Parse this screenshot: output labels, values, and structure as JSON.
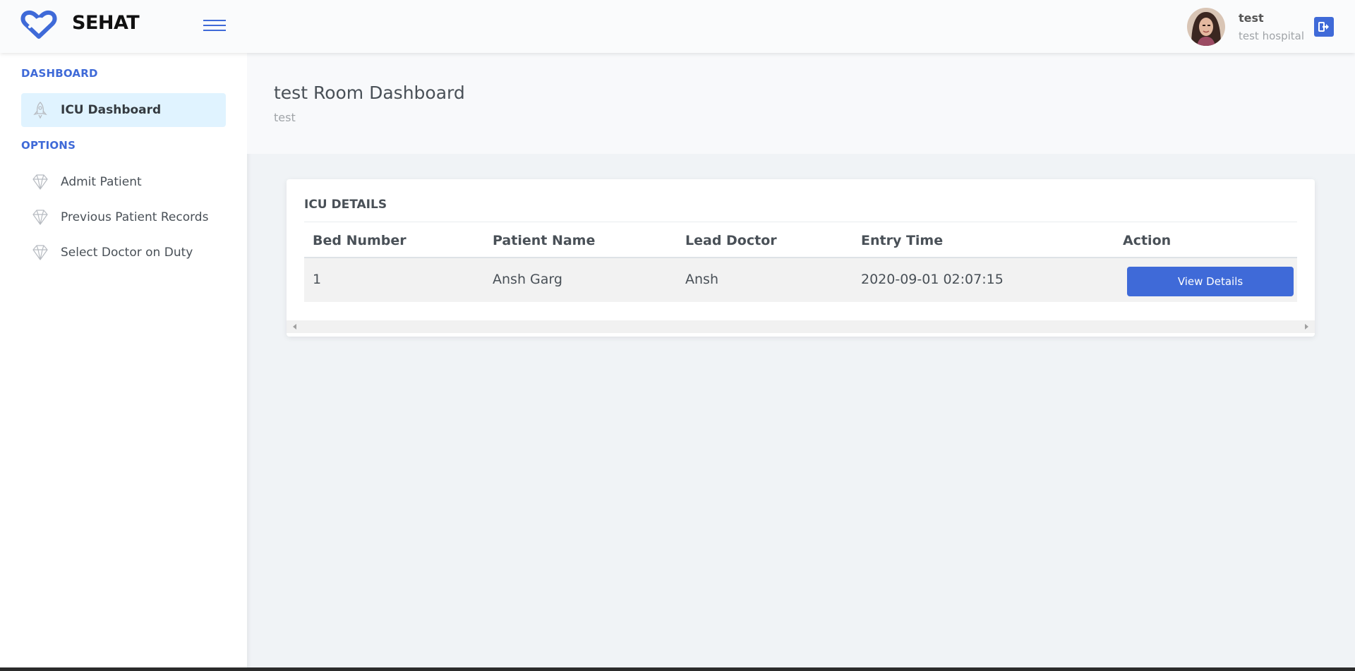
{
  "header": {
    "brand": "SEHAT",
    "user_name": "test",
    "user_hospital": "test hospital"
  },
  "sidebar": {
    "dashboard_section": "DASHBOARD",
    "dashboard_item": "ICU Dashboard",
    "options_section": "OPTIONS",
    "options_items": [
      {
        "label": "Admit Patient"
      },
      {
        "label": "Previous Patient Records"
      },
      {
        "label": "Select Doctor on Duty"
      }
    ]
  },
  "page": {
    "title": "test Room Dashboard",
    "subtitle": "test"
  },
  "card": {
    "title": "ICU DETAILS",
    "columns": [
      "Bed Number",
      "Patient Name",
      "Lead Doctor",
      "Entry Time",
      "Action"
    ],
    "rows": [
      {
        "bed_number": "1",
        "patient_name": "Ansh Garg",
        "lead_doctor": "Ansh",
        "entry_time": "2020-09-01 02:07:15",
        "action_label": "View Details"
      }
    ]
  },
  "colors": {
    "accent": "#3f6ad8",
    "active_bg": "#e0f3ff"
  }
}
